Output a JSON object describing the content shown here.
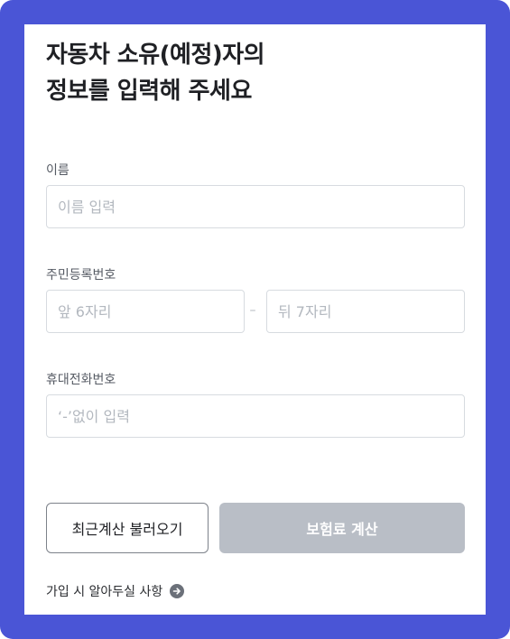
{
  "form": {
    "title_line1": "자동차 소유(예정)자의",
    "title_line2": "정보를 입력해 주세요",
    "name": {
      "label": "이름",
      "placeholder": "이름 입력",
      "value": ""
    },
    "rrn": {
      "label": "주민등록번호",
      "front_placeholder": "앞 6자리",
      "separator": "–",
      "back_placeholder": "뒤 7자리"
    },
    "phone": {
      "label": "휴대전화번호",
      "placeholder": "‘-’없이 입력",
      "value": ""
    },
    "buttons": {
      "recent_label": "최근계산 불러오기",
      "calc_label": "보험료 계산"
    },
    "notice": "가입 시 알아두실 사항"
  },
  "colors": {
    "frame": "#4a55d6",
    "disabled_button": "#b9bec6",
    "border": "#d7dbe0"
  },
  "icons": {
    "notice_icon": "arrow-right-circle-icon"
  }
}
